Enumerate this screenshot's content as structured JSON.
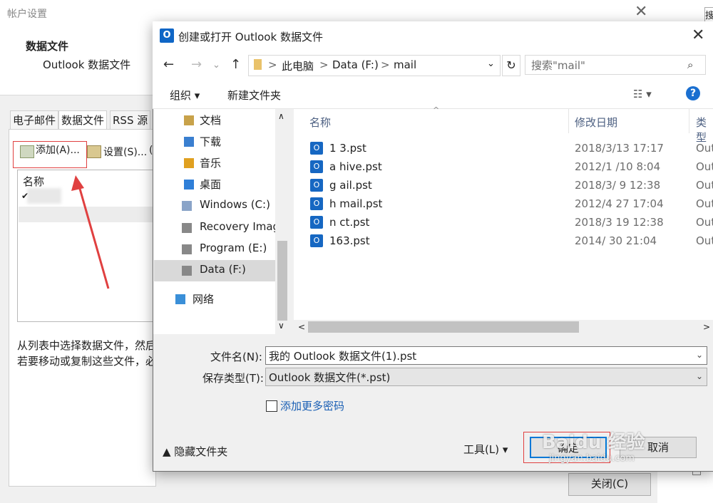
{
  "bg": {
    "window_title": "帐户设置",
    "close_glyph": "✕",
    "header_title": "数据文件",
    "header_subtitle": "Outlook 数据文件",
    "tabs": [
      "电子邮件",
      "数据文件",
      "RSS 源"
    ],
    "add_label": "添加(A)...",
    "settings_label": "设置(S)...",
    "settings_paren": "(",
    "list_header": "名称",
    "check": "✔",
    "note1": "从列表中选择数据文件，然后",
    "note2": "若要移动或复制这些文件，必",
    "close_button": "关闭(C)",
    "right_strip_btn": "搜"
  },
  "dialog": {
    "title": "创建或打开 Outlook 数据文件",
    "close_glyph": "✕",
    "app_icon_letter": "O",
    "nav": {
      "back": "←",
      "forward": "→",
      "dropdown": "⌄",
      "up": "↑"
    },
    "breadcrumb": [
      "此电脑",
      "Data (F:)",
      "mail"
    ],
    "crumb_sep": ">",
    "addr_dropdown": "⌄",
    "refresh": "↻",
    "search_placeholder": "搜索\"mail\"",
    "search_icon": "⌕",
    "toolbar": {
      "organize": "组织 ▾",
      "new_folder": "新建文件夹",
      "view": "☷ ▾",
      "help": "?"
    },
    "nav_pane": [
      {
        "label": "文档",
        "icon_color": "#c8a24a"
      },
      {
        "label": "下载",
        "icon_color": "#3a7fd0"
      },
      {
        "label": "音乐",
        "icon_color": "#e0a020"
      },
      {
        "label": "桌面",
        "icon_color": "#2f7fd8"
      },
      {
        "label": "Windows (C:)",
        "icon_color": "#8aa4c8"
      },
      {
        "label": "Recovery Image",
        "icon_color": "#888888"
      },
      {
        "label": "Program (E:)",
        "icon_color": "#888888"
      },
      {
        "label": "Data (F:)",
        "icon_color": "#888888"
      },
      {
        "label": "网络",
        "icon_color": "#3a8fd8"
      }
    ],
    "nav_scroll_up": "∧",
    "nav_scroll_down": "∨",
    "columns": [
      "名称",
      "修改日期",
      "类型"
    ],
    "sort_arrow": "^",
    "files": [
      {
        "name": "1 3.pst",
        "date": "2018/3/13 17:17",
        "type": "Out"
      },
      {
        "name": "a hive.pst",
        "date": "2012/1 /10 8:04",
        "type": "Out"
      },
      {
        "name": "g ail.pst",
        "date": "2018/3/ 9 12:38",
        "type": "Out"
      },
      {
        "name": "h mail.pst",
        "date": "2012/4 27 17:04",
        "type": "Out"
      },
      {
        "name": "n ct.pst",
        "date": "2018/3 19 12:38",
        "type": "Out"
      },
      {
        "name": "163.pst",
        "date": "2014/ 30 21:04",
        "type": "Out"
      }
    ],
    "hscroll_left": "<",
    "hscroll_right": ">",
    "filename_label": "文件名(N):",
    "filename_value": "我的 Outlook 数据文件(1).pst",
    "filetype_label": "保存类型(T):",
    "filetype_value": "Outlook 数据文件(*.pst)",
    "dd_arrow": "⌄",
    "add_passwords": "添加更多密码",
    "hide_folders": "▲ 隐藏文件夹",
    "tools": "工具(L)   ▾",
    "ok": "确定",
    "cancel": "取消"
  },
  "watermark": {
    "brand": "Baidu 经验",
    "url": "jingyan.baidu.com"
  },
  "colors": {
    "accent": "#0078d7",
    "annotation_red": "#e04040",
    "outlook_blue": "#1667c2"
  }
}
